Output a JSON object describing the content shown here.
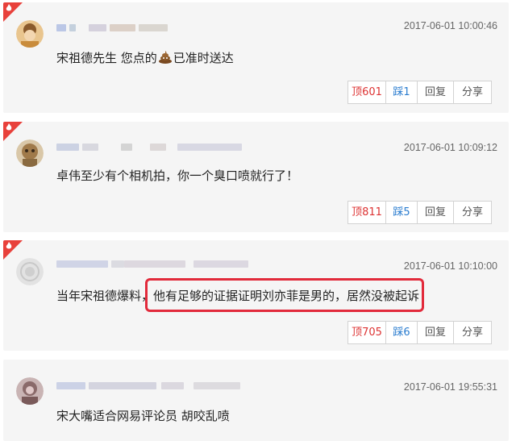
{
  "comments": [
    {
      "time": "2017-06-01 10:00:46",
      "text_before": "宋祖德先生 您点的",
      "emoji": "poop-emoji",
      "text_after": "已准时送达",
      "actions": {
        "up": "顶601",
        "down": "踩1",
        "reply": "回复",
        "share": "分享"
      },
      "hot": true
    },
    {
      "time": "2017-06-01 10:09:12",
      "text": "卓伟至少有个相机拍，你一个臭口喷就行了！",
      "actions": {
        "up": "顶811",
        "down": "踩5",
        "reply": "回复",
        "share": "分享"
      },
      "hot": true
    },
    {
      "time": "2017-06-01 10:10:00",
      "text": "当年宋祖德爆料，他有足够的证据证明刘亦菲是男的，居然没被起诉",
      "actions": {
        "up": "顶705",
        "down": "踩6",
        "reply": "回复",
        "share": "分享"
      },
      "hot": true
    },
    {
      "time": "2017-06-01 19:55:31",
      "text": "宋大嘴适合网易评论员 胡咬乱喷",
      "hot": false
    }
  ],
  "colors": {
    "hot_corner": "#e8413b",
    "up_text": "#dd3333",
    "down_text": "#2a7ccf",
    "highlight_border": "#e22a3b"
  }
}
